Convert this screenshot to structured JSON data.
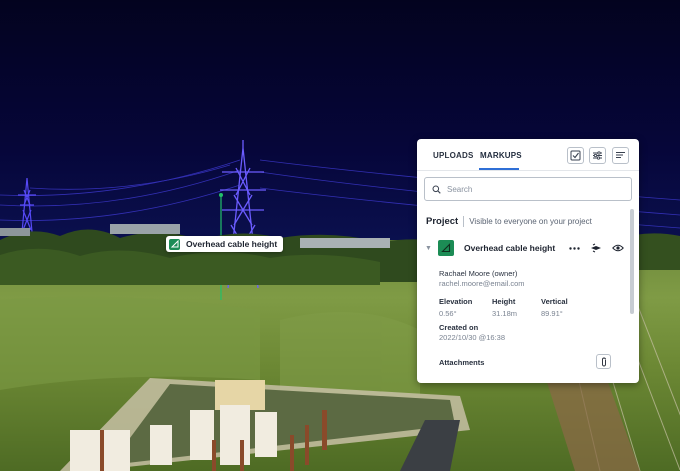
{
  "scene": {
    "label": "Overhead cable height"
  },
  "panel": {
    "tabs": [
      {
        "label": "UPLOADS",
        "active": false
      },
      {
        "label": "MARKUPS",
        "active": true
      }
    ],
    "toolbar_icons": [
      "checklist-icon",
      "filter-sliders-icon",
      "sort-lines-icon"
    ],
    "search": {
      "placeholder": "Search",
      "value": ""
    },
    "project": {
      "title": "Project",
      "visibility": "Visible to everyone on your project"
    },
    "markup": {
      "title": "Overhead cable height",
      "owner": "Rachael Moore (owner)",
      "email": "rachel.moore@email.com",
      "stats": [
        {
          "label": "Elevation",
          "value": "0.56°"
        },
        {
          "label": "Height",
          "value": "31.18m"
        },
        {
          "label": "Vertical",
          "value": "89.91°"
        }
      ],
      "created_label": "Created on",
      "created_value": "2022/10/30 @16:38",
      "attachments_label": "Attachments"
    }
  },
  "colors": {
    "accent": "#2f6fd6",
    "markup_green": "#1c8c55",
    "sky": "#05052a"
  }
}
